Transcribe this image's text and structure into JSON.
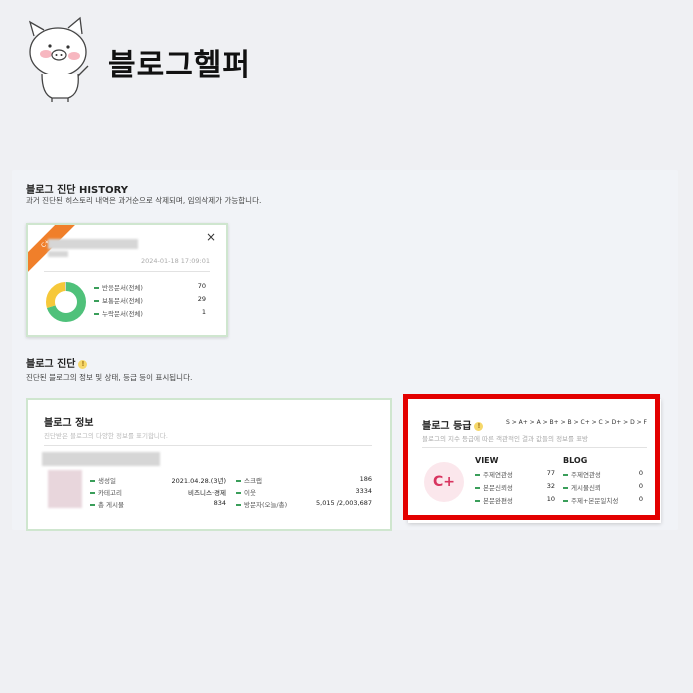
{
  "header": {
    "app_title": "블로그헬퍼"
  },
  "history": {
    "title": "블로그 진단 HISTORY",
    "subtitle": "과거 진단된 히스토리 내역은 과거순으로 삭제되며, 임의삭제가 가능합니다.",
    "card": {
      "ribbon_label": "C+",
      "date": "2024-01-18 17:09:01",
      "close_label": "×",
      "legend": [
        {
          "label": "반응문서(전체)",
          "value": "70"
        },
        {
          "label": "보통문서(전체)",
          "value": "29"
        },
        {
          "label": "누락문서(전체)",
          "value": "1"
        }
      ],
      "donut": {
        "green": 70,
        "yellow": 29,
        "gray": 1
      }
    }
  },
  "diagnosis": {
    "title": "블로그 진단",
    "subtitle": "진단된 블로그의 정보 및 상태, 등급 등이 표시됩니다."
  },
  "blog_info": {
    "title": "블로그 정보",
    "subtitle": "진단받은 블로그의 다양한 정보를 표기합니다.",
    "left": [
      {
        "label": "생성일",
        "value": "2021.04.28.(3년)"
      },
      {
        "label": "카테고리",
        "value": "비즈니스·경제"
      },
      {
        "label": "총 게시물",
        "value": "834"
      }
    ],
    "right": [
      {
        "label": "스크랩",
        "value": "186"
      },
      {
        "label": "이웃",
        "value": "3334"
      },
      {
        "label": "방문자(오늘/총)",
        "value": "5,015 /2,003,687"
      }
    ]
  },
  "blog_grade": {
    "title": "블로그 등급",
    "scale": "S > A+ > A > B+ > B > C+ > C > D+ > D > F",
    "subtitle": "블로그의 지수 등급에 따른 객관적인 결과 값들의 정보를 표방",
    "grade": "C+",
    "view": {
      "heading": "VIEW",
      "rows": [
        {
          "label": "주제연관성",
          "value": "77"
        },
        {
          "label": "본문신뢰성",
          "value": "32"
        },
        {
          "label": "본문완편성",
          "value": "10"
        }
      ]
    },
    "blog": {
      "heading": "BLOG",
      "rows": [
        {
          "label": "주제연관성",
          "value": "0"
        },
        {
          "label": "게시물신뢰",
          "value": "0"
        },
        {
          "label": "주제+본문일치성",
          "value": "0"
        }
      ]
    }
  },
  "colors": {
    "accent_green": "#3a9e5a",
    "donut_green": "#4fc17a",
    "donut_yellow": "#f6c83a",
    "ribbon_orange": "#f07f2a",
    "highlight_red": "#e30000",
    "grade_pink": "#d8345f"
  }
}
